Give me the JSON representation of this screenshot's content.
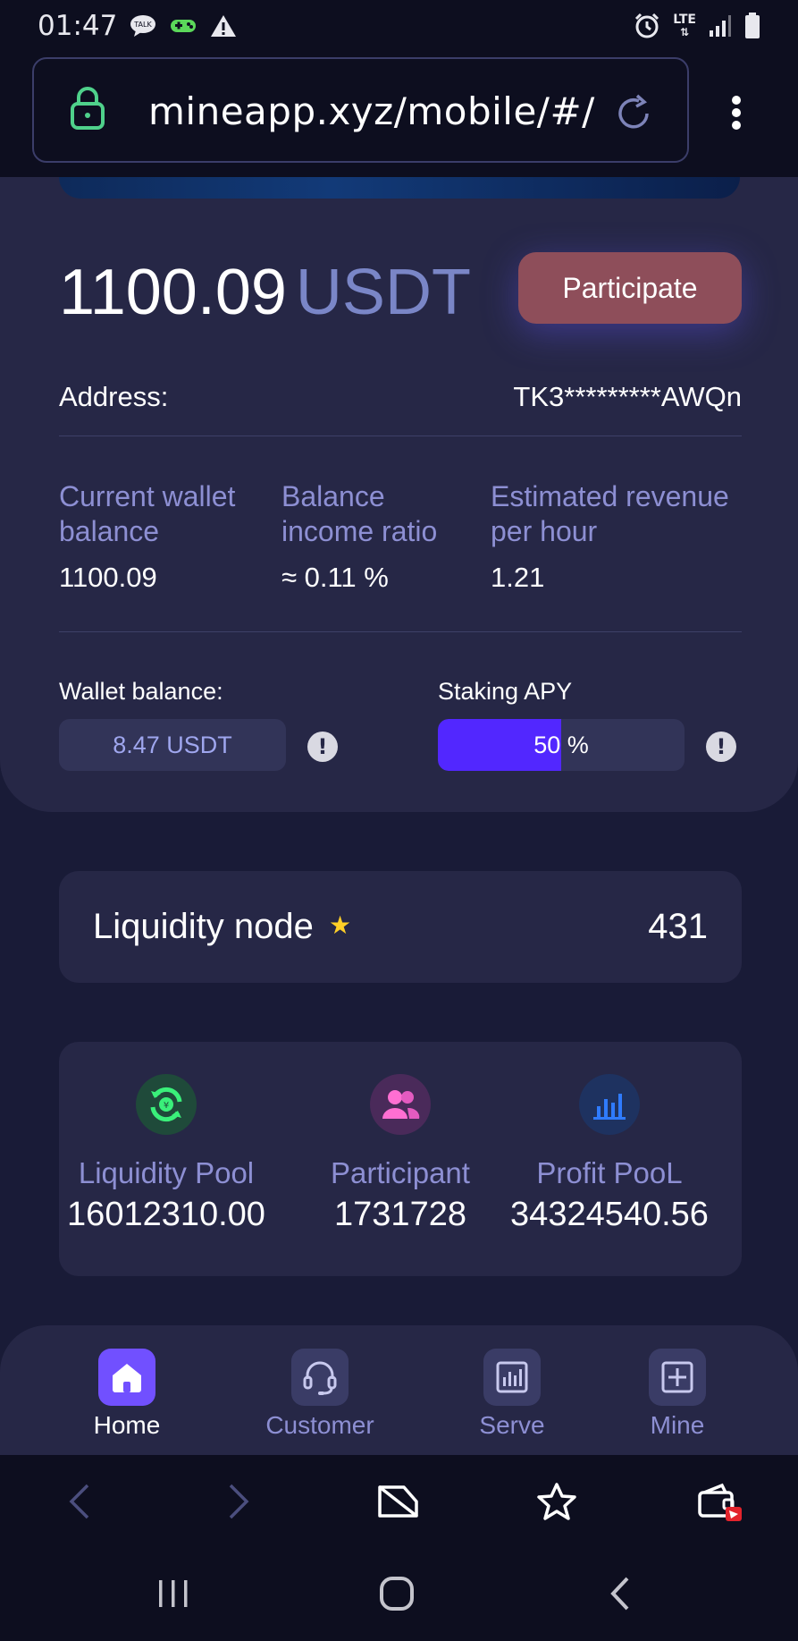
{
  "status_bar": {
    "time": "01:47",
    "left_icons": [
      "talk-icon",
      "gamepad-icon",
      "warning-icon"
    ],
    "right_icons": [
      "alarm-icon",
      "lte-icon",
      "signal-icon",
      "battery-icon"
    ],
    "network_label": "LTE"
  },
  "browser": {
    "url": "mineapp.xyz/mobile/#/"
  },
  "summary": {
    "amount": "1100.09",
    "currency": "USDT",
    "participate_label": "Participate",
    "address_label": "Address:",
    "address_value": "TK3*********AWQn"
  },
  "stats": [
    {
      "label": "Current wallet balance",
      "value": "1100.09"
    },
    {
      "label": "Balance income ratio",
      "value": "≈ 0.11 %"
    },
    {
      "label": "Estimated revenue per hour",
      "value": "1.21"
    }
  ],
  "wallet": {
    "label": "Wallet balance:",
    "value": "8.47 USDT"
  },
  "staking": {
    "label": "Staking APY",
    "value_text": "50 %",
    "fill_fraction": 0.5
  },
  "liquidity_node": {
    "title": "Liquidity node",
    "count": "431"
  },
  "pools": [
    {
      "label": "Liquidity Pool",
      "value": "16012310.00",
      "icon": "liquidity-pool-icon"
    },
    {
      "label": "Participant",
      "value": "1731728",
      "icon": "participants-icon"
    },
    {
      "label": "Profit PooL",
      "value": "34324540.56",
      "icon": "bar-chart-icon"
    }
  ],
  "app_nav": [
    {
      "label": "Home",
      "icon": "home-icon",
      "active": true
    },
    {
      "label": "Customer",
      "icon": "headset-icon",
      "active": false
    },
    {
      "label": "Serve",
      "icon": "chart-icon",
      "active": false
    },
    {
      "label": "Mine",
      "icon": "plus-square-icon",
      "active": false
    }
  ],
  "colors": {
    "background": "#191b37",
    "card": "#262746",
    "accent_purple": "#7150ff",
    "apy_fill": "#5227ff",
    "participate_button": "#8e4e5a",
    "muted_label": "#8d8fd3",
    "star": "#ffcf27"
  }
}
